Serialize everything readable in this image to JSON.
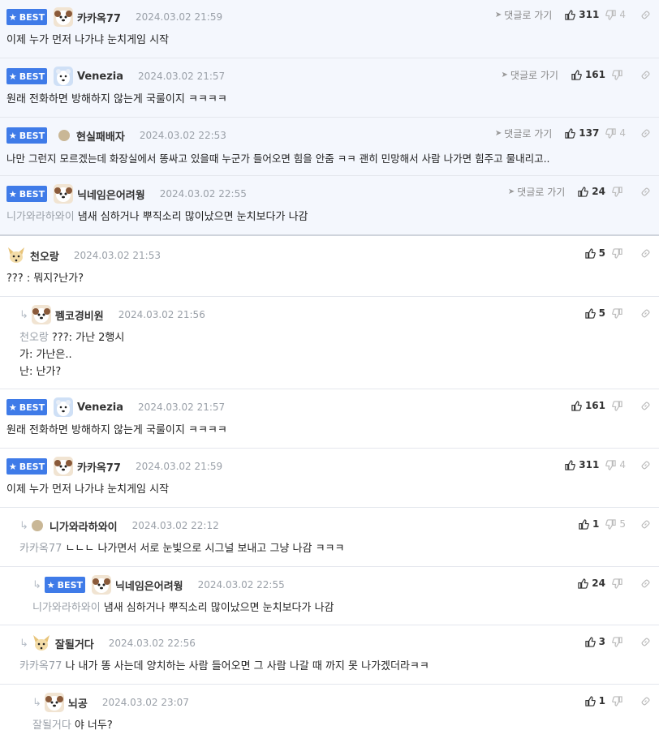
{
  "comments": [
    {
      "best": true,
      "avatar": "dog-avatar-icon",
      "nick": "카카옥77",
      "date": "2024.03.02 21:59",
      "goto": "댓글로 가기",
      "likes": "311",
      "dislikes": "4",
      "mention": "",
      "text": "이제 누가 먼저 나가냐 눈치게임 시작"
    },
    {
      "best": true,
      "avatar": "white-dog-avatar-icon",
      "nick": "Venezia",
      "date": "2024.03.02 21:57",
      "goto": "댓글로 가기",
      "likes": "161",
      "dislikes": "",
      "mention": "",
      "text": "원래 전화하면 방해하지 않는게 국룰이지 ㅋㅋㅋㅋ"
    },
    {
      "best": true,
      "avatar": "default-dot-icon",
      "nick": "현실패배자",
      "date": "2024.03.02 22:53",
      "goto": "댓글로 가기",
      "likes": "137",
      "dislikes": "4",
      "mention": "",
      "text": "나만 그런지 모르겠는데 화장실에서 똥싸고 있을때 누군가 들어오면 힘을 안줌 ㅋㅋ 괜히 민망해서 사람 나가면 힘주고 물내리고.."
    },
    {
      "best": true,
      "avatar": "dog-avatar-icon",
      "nick": "닉네임은어려웡",
      "date": "2024.03.02 22:55",
      "goto": "댓글로 가기",
      "likes": "24",
      "dislikes": "",
      "mention": "니가와라하와이",
      "text": "냄새 심하거나 뿌직소리 많이났으면 눈치보다가 나감"
    },
    {
      "best": false,
      "avatar": "fox-avatar-icon",
      "nick": "천오랑",
      "date": "2024.03.02 21:53",
      "likes": "5",
      "dislikes": "",
      "mention": "",
      "text": "??? : 뭐지?난가?"
    },
    {
      "best": false,
      "avatar": "dog-avatar-icon",
      "nick": "펨코경비원",
      "date": "2024.03.02 21:56",
      "likes": "5",
      "dislikes": "",
      "mention": "천오랑",
      "text": "???: 가난 2행시\n가: 가난은..\n난: 난가?"
    },
    {
      "best": true,
      "avatar": "white-dog-avatar-icon",
      "nick": "Venezia",
      "date": "2024.03.02 21:57",
      "likes": "161",
      "dislikes": "",
      "mention": "",
      "text": "원래 전화하면 방해하지 않는게 국룰이지 ㅋㅋㅋㅋ"
    },
    {
      "best": true,
      "avatar": "dog-avatar-icon",
      "nick": "카카옥77",
      "date": "2024.03.02 21:59",
      "likes": "311",
      "dislikes": "4",
      "mention": "",
      "text": "이제 누가 먼저 나가냐 눈치게임 시작"
    },
    {
      "best": false,
      "avatar": "default-dot-icon",
      "nick": "니가와라하와이",
      "date": "2024.03.02 22:12",
      "likes": "1",
      "dislikes": "5",
      "mention": "카카옥77",
      "text": "ㄴㄴㄴ 나가면서 서로 눈빛으로 시그널 보내고 그냥 나감 ㅋㅋㅋ"
    },
    {
      "best": true,
      "avatar": "dog-avatar-icon",
      "nick": "닉네임은어려웡",
      "date": "2024.03.02 22:55",
      "likes": "24",
      "dislikes": "",
      "mention": "니가와라하와이",
      "text": "냄새 심하거나 뿌직소리 많이났으면 눈치보다가 나감"
    },
    {
      "best": false,
      "avatar": "fox-avatar-icon",
      "nick": "잘될거다",
      "date": "2024.03.02 22:56",
      "likes": "3",
      "dislikes": "",
      "mention": "카카옥77",
      "text": "나 내가 똥 사는데 양치하는 사람 들어오면 그 사람 나갈 때 까지 못 나가겠더라ㅋㅋ"
    },
    {
      "best": false,
      "avatar": "dog-avatar-icon",
      "nick": "뇌공",
      "date": "2024.03.02 23:07",
      "likes": "1",
      "dislikes": "",
      "mention": "잘될거다",
      "text": "야 너두?"
    }
  ],
  "best_label": "BEST"
}
